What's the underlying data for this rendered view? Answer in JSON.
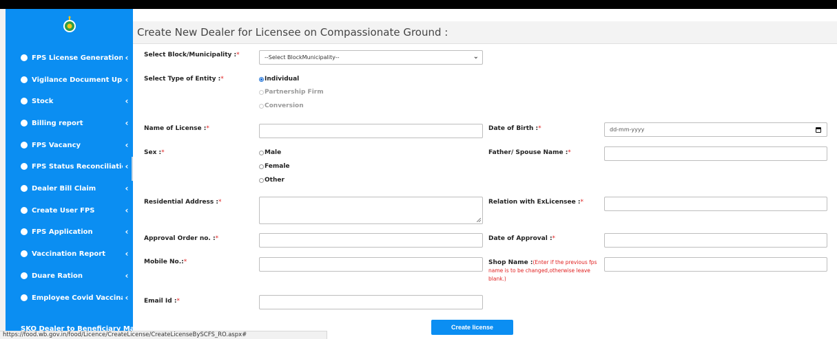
{
  "sidebar": {
    "items": [
      {
        "label": "FPS License Generation"
      },
      {
        "label": "Vigilance Document Upload"
      },
      {
        "label": "Stock"
      },
      {
        "label": "Billing report"
      },
      {
        "label": "FPS Vacancy"
      },
      {
        "label": "FPS Status Reconciliation"
      },
      {
        "label": "Dealer Bill Claim"
      },
      {
        "label": "Create User FPS"
      },
      {
        "label": "FPS Application"
      },
      {
        "label": "Vaccination Report"
      },
      {
        "label": "Duare Ration"
      },
      {
        "label": "Employee Covid Vaccination"
      }
    ],
    "partial_item": "SKO Dealer to Beneficiary Mappi"
  },
  "page": {
    "title": "Create New Dealer for Licensee on Compassionate Ground :"
  },
  "form": {
    "required_mark": "*",
    "block_label": "Select Block/Municipality :",
    "block_selected": "--Select BlockMunicipality--",
    "entity_label": "Select Type of Entity :",
    "entity_options": [
      "Individual",
      "Partnership Firm",
      "Conversion"
    ],
    "entity_selected": "Individual",
    "name_label": "Name of License :",
    "dob_label": "Date of Birth :",
    "dob_placeholder": "dd-mm-yyyy",
    "sex_label": "Sex :",
    "sex_options": [
      "Male",
      "Female",
      "Other"
    ],
    "father_label": "Father/ Spouse Name :",
    "address_label": "Residential Address :",
    "relation_label": "Relation with ExLicensee :",
    "approval_no_label": "Approval Order no. :",
    "approval_date_label": "Date of Approval :",
    "mobile_label": "Mobile No.:",
    "shop_label": "Shop Name :",
    "shop_note": "(Enter if the previous fps name is to be changed,otherwise leave blank.)",
    "email_label": "Email Id :",
    "submit_label": "Create license"
  },
  "statusbar": {
    "url": "https://food.wb.gov.in/food/Licence/CreateLicense/CreateLicenseBySCFS_RO.aspx#"
  },
  "colors": {
    "sidebar": "#0b8ef2",
    "required": "#e02020",
    "button": "#0b8ef2"
  }
}
